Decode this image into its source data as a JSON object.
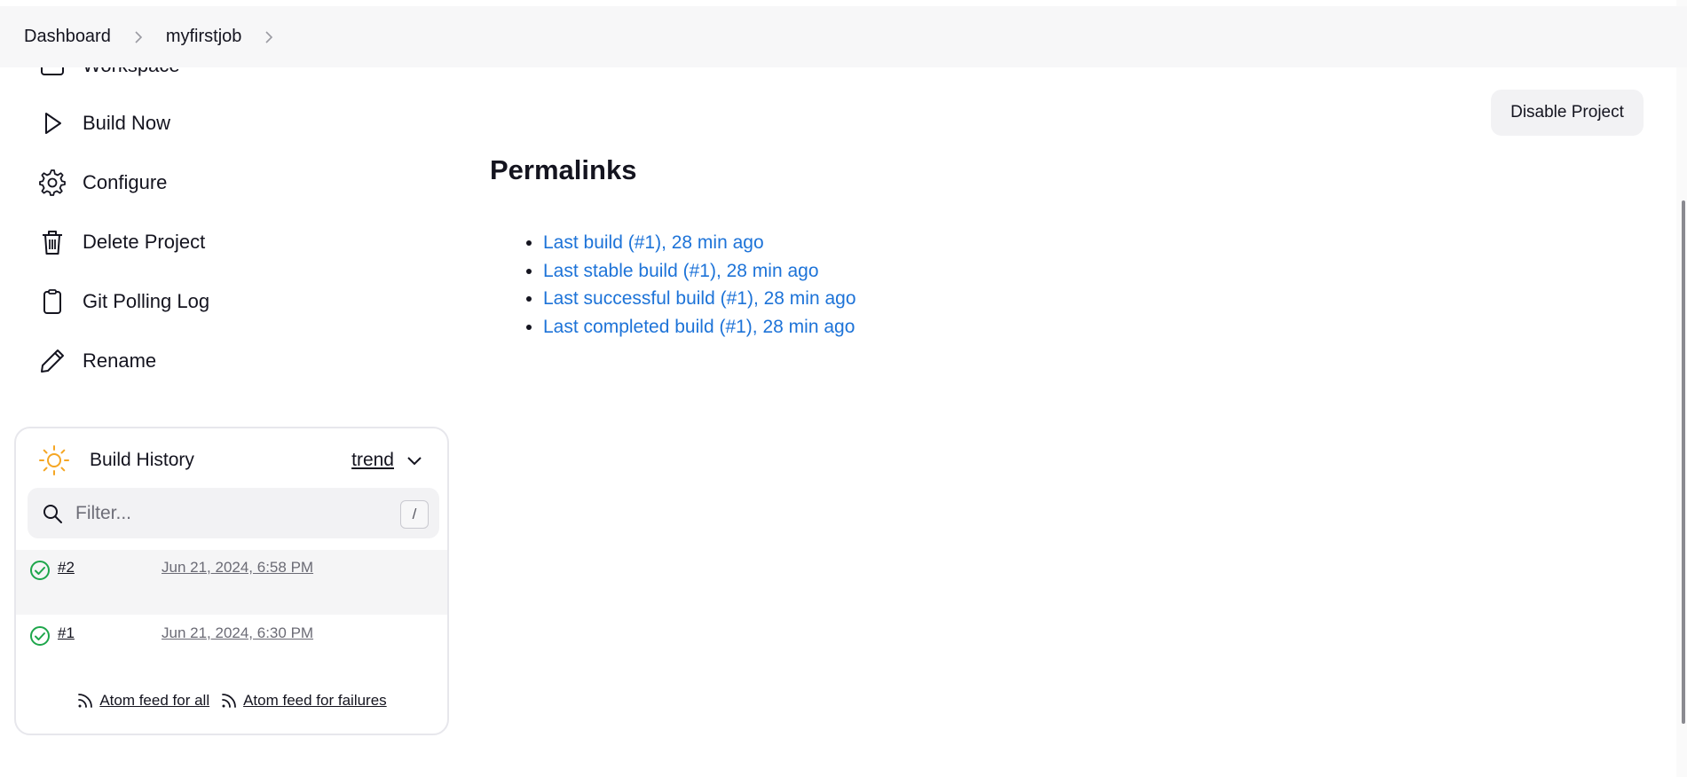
{
  "breadcrumb": {
    "items": [
      "Dashboard",
      "myfirstjob"
    ]
  },
  "sidebar": {
    "items": [
      {
        "label": "Workspace",
        "icon": "folder-icon"
      },
      {
        "label": "Build Now",
        "icon": "play-icon"
      },
      {
        "label": "Configure",
        "icon": "gear-icon"
      },
      {
        "label": "Delete Project",
        "icon": "trash-icon"
      },
      {
        "label": "Git Polling Log",
        "icon": "clipboard-icon"
      },
      {
        "label": "Rename",
        "icon": "pencil-icon"
      }
    ]
  },
  "build_history": {
    "title": "Build History",
    "trend_label": "trend",
    "filter_placeholder": "Filter...",
    "shortcut_key": "/",
    "builds": [
      {
        "number": "#2",
        "date": "Jun 21, 2024, 6:58 PM",
        "status": "success"
      },
      {
        "number": "#1",
        "date": "Jun 21, 2024, 6:30 PM",
        "status": "success"
      }
    ],
    "feeds": {
      "all": "Atom feed for all",
      "failures": "Atom feed for failures"
    }
  },
  "main": {
    "disable_button": "Disable Project",
    "permalinks_title": "Permalinks",
    "permalinks": [
      "Last build (#1), 28 min ago",
      "Last stable build (#1), 28 min ago",
      "Last successful build (#1), 28 min ago",
      "Last completed build (#1), 28 min ago"
    ]
  },
  "colors": {
    "link": "#1d73d8",
    "success": "#1ea64b",
    "sun": "#f5a623"
  }
}
